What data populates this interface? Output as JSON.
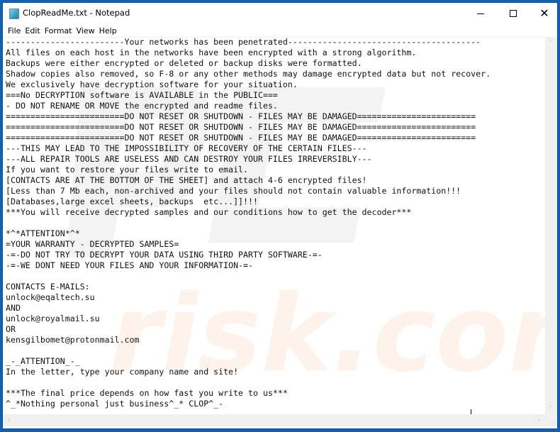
{
  "window": {
    "title": "ClopReadMe.txt - Notepad",
    "app_icon": "notepad-icon",
    "controls": {
      "minimize": "minimize-icon",
      "maximize": "maximize-icon",
      "close": "close-icon",
      "close_glyph": "✕"
    }
  },
  "menu": {
    "items": [
      {
        "label": "File"
      },
      {
        "label": "Edit"
      },
      {
        "label": "Format"
      },
      {
        "label": "View"
      },
      {
        "label": "Help"
      }
    ]
  },
  "document": {
    "lines": [
      "------------------------Your networks has been penetrated---------------------------------------",
      "All files on each host in the networks have been encrypted with a strong algorithm.",
      "Backups were either encrypted or deleted or backup disks were formatted.",
      "Shadow copies also removed, so F-8 or any other methods may damage encrypted data but not recover.",
      "We exclusively have decryption software for your situation.",
      "===No DECRYPTION software is AVAILABLE in the PUBLIC===",
      "- DO NOT RENAME OR MOVE the encrypted and readme files.",
      "========================DO NOT RESET OR SHUTDOWN - FILES MAY BE DAMAGED========================",
      "========================DO NOT RESET OR SHUTDOWN - FILES MAY BE DAMAGED========================",
      "========================DO NOT RESET OR SHUTDOWN - FILES MAY BE DAMAGED========================",
      "---THIS MAY LEAD TO THE IMPOSSIBILITY OF RECOVERY OF THE CERTAIN FILES---",
      "---ALL REPAIR TOOLS ARE USELESS AND CAN DESTROY YOUR FILES IRREVERSIBLY---",
      "If you want to restore your files write to email.",
      "[CONTACTS ARE AT THE BOTTOM OF THE SHEET] and attach 4-6 encrypted files!",
      "[Less than 7 Mb each, non-archived and your files should not contain valuable information!!!",
      "[Databases,large excel sheets, backups  etc...]]!!!",
      "***You will receive decrypted samples and our conditions how to get the decoder***",
      "",
      "*^*ATTENTION*^*",
      "=YOUR WARRANTY - DECRYPTED SAMPLES=",
      "-=-DO NOT TRY TO DECRYPT YOUR DATA USING THIRD PARTY SOFTWARE-=-",
      "-=-WE DONT NEED YOUR FILES AND YOUR INFORMATION-=-",
      "",
      "CONTACTS E-MAILS:",
      "unlock@eqaltech.su",
      "AND",
      "unlock@royalmail.su",
      "OR",
      "kensgilbomet@protonmail.com",
      "",
      "_-_ATTENTION_-_",
      "In the letter, type your company name and site!",
      "",
      "***The final price depends on how fast you write to us***",
      "^_*Nothing personal just business^_* CLOP^_-",
      "----------------------------------------------------------------------------------------------"
    ]
  },
  "watermark": {
    "text": "risk.com",
    "logo": "pc-logo"
  },
  "scrollbars": {
    "up_arrow": "˄",
    "down_arrow": "˅",
    "left_arrow": "‹",
    "right_arrow": "›",
    "grip": "⋰"
  },
  "colors": {
    "desktop_border": "#1160b4",
    "text": "#111111",
    "watermark": "#f2f2f2",
    "watermark_accent": "#fdf1e6"
  }
}
